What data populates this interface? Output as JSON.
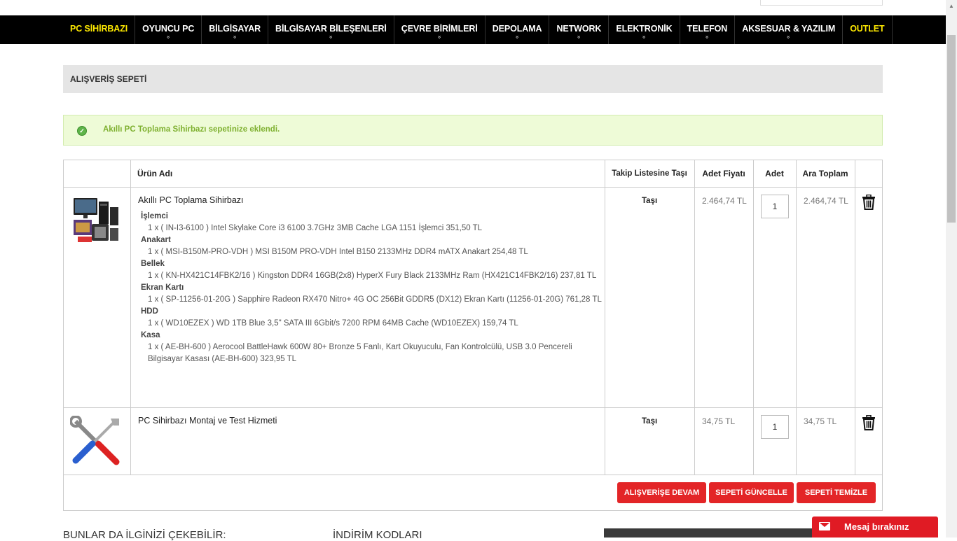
{
  "nav": {
    "items": [
      {
        "label": "PC SİHİRBAZI",
        "chevron": ""
      },
      {
        "label": "OYUNCU PC",
        "chevron": "»"
      },
      {
        "label": "BİLGİSAYAR",
        "chevron": "»"
      },
      {
        "label": "BİLGİSAYAR BİLEŞENLERİ",
        "chevron": "»"
      },
      {
        "label": "ÇEVRE BİRİMLERİ",
        "chevron": "»"
      },
      {
        "label": "DEPOLAMA",
        "chevron": "»"
      },
      {
        "label": "NETWORK",
        "chevron": "»"
      },
      {
        "label": "ELEKTRONİK",
        "chevron": "»"
      },
      {
        "label": "TELEFON",
        "chevron": "»"
      },
      {
        "label": "AKSESUAR & YAZILIM",
        "chevron": "»"
      },
      {
        "label": "OUTLET",
        "chevron": ""
      }
    ]
  },
  "page_title": "ALIŞVERİŞ SEPETİ",
  "alert": {
    "icon": "check-circle-icon",
    "message": "Akıllı PC Toplama Sihirbazı sepetinize eklendi."
  },
  "table": {
    "headers": {
      "name": "Ürün Adı",
      "move": "Takip Listesine Taşı",
      "unit_price": "Adet Fiyatı",
      "qty": "Adet",
      "subtotal": "Ara Toplam"
    },
    "rows": [
      {
        "name": "Akıllı PC Toplama Sihirbazı",
        "move": "Taşı",
        "unit_price": "2.464,74 TL",
        "qty": "1",
        "subtotal": "2.464,74 TL",
        "specs": [
          {
            "cat": "İşlemci",
            "item": "1 x ( IN-I3-6100 ) Intel Skylake Core i3 6100 3.7GHz 3MB Cache LGA 1151 İşlemci 351,50 TL"
          },
          {
            "cat": "Anakart",
            "item": "1 x ( MSI-B150M-PRO-VDH ) MSI B150M PRO-VDH Intel B150 2133MHz DDR4 mATX Anakart 254,48 TL"
          },
          {
            "cat": "Bellek",
            "item": "1 x ( KN-HX421C14FBK2/16 ) Kingston DDR4 16GB(2x8) HyperX Fury Black 2133MHz Ram (HX421C14FBK2/16) 237,81 TL"
          },
          {
            "cat": "Ekran Kartı",
            "item": "1 x ( SP-11256-01-20G ) Sapphire Radeon RX470 Nitro+ 4G OC 256Bit GDDR5 (DX12) Ekran Kartı (11256-01-20G) 761,28 TL"
          },
          {
            "cat": "HDD",
            "item": "1 x ( WD10EZEX ) WD 1TB Blue 3,5\" SATA III 6Gbit/s 7200 RPM 64MB Cache (WD10EZEX) 159,74 TL"
          },
          {
            "cat": "Kasa",
            "item": "1 x ( AE-BH-600 ) Aerocool BattleHawk 600W 80+ Bronze 5 Fanlı, Kart Okuyuculu, Fan Kontrolcülü, USB 3.0 Pencereli Bilgisayar Kasası (AE-BH-600) 323,95 TL"
          }
        ]
      },
      {
        "name": "PC Sihirbazı Montaj ve Test Hizmeti",
        "move": "Taşı",
        "unit_price": "34,75 TL",
        "qty": "1",
        "subtotal": "34,75 TL"
      }
    ]
  },
  "buttons": {
    "continue": "ALIŞVERİŞE DEVAM",
    "update": "SEPETİ GÜNCELLE",
    "clear": "SEPETİ TEMİZLE"
  },
  "below": {
    "related": "BUNLAR DA İLGİNİZİ ÇEKEBİLİR:",
    "discount": "İNDİRİM KODLARI"
  },
  "chat": {
    "label": "Mesaj bırakınız",
    "icon": "envelope-icon"
  },
  "colors": {
    "accent": "#e32527",
    "nav_bg": "#000000",
    "nav_highlight": "#ffea00",
    "alert_text": "#7eb02f"
  }
}
